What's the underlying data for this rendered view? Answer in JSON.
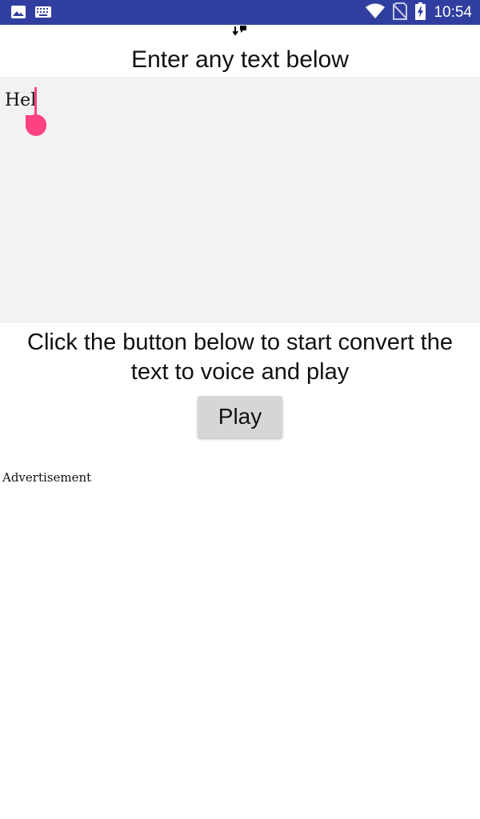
{
  "status_bar": {
    "time": "10:54",
    "background": "#303f9f",
    "left_icons": [
      "image-icon",
      "keyboard-icon"
    ],
    "right_icons": [
      "wifi-icon",
      "no-sim-icon",
      "battery-charging-icon"
    ]
  },
  "header": {
    "title": "Enter any text below"
  },
  "input": {
    "value": "Hel",
    "accent": "#ff4081"
  },
  "instruction": {
    "text": "Click the button below to start convert the text to voice and play"
  },
  "play_button": {
    "label": "Play"
  },
  "ad": {
    "label": "Advertisement"
  }
}
